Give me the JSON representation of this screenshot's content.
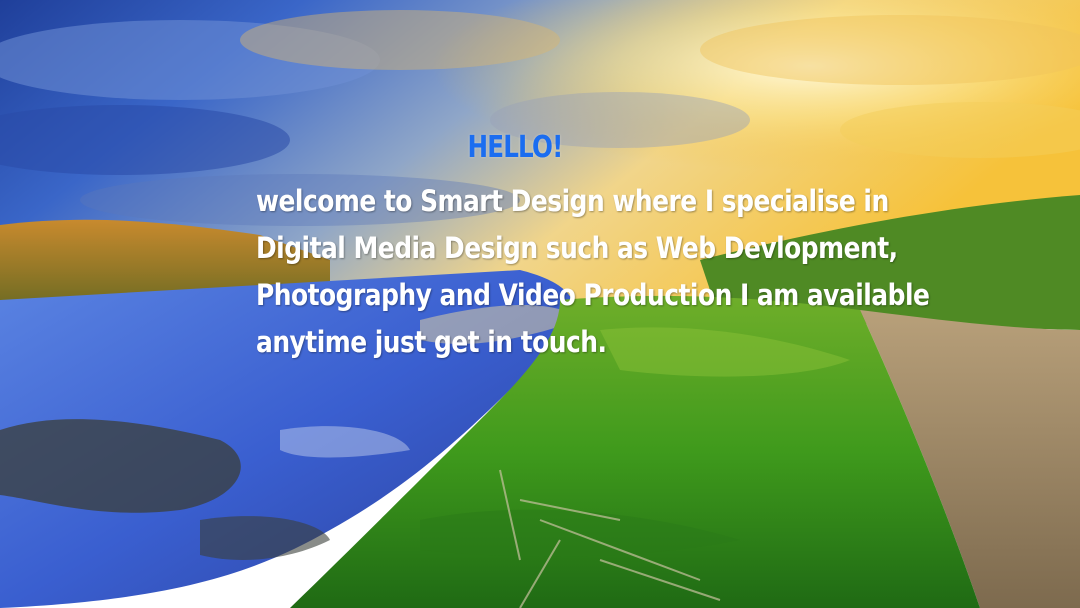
{
  "hero": {
    "greeting": "HELLO!",
    "welcome_text": "welcome to Smart Design where I specialise in Digital Media Design such as Web Devlopment, Photography and Video Production I am available anytime just get in touch."
  },
  "colors": {
    "greeting": "#1b6df0",
    "welcome_text": "#ffffff"
  }
}
